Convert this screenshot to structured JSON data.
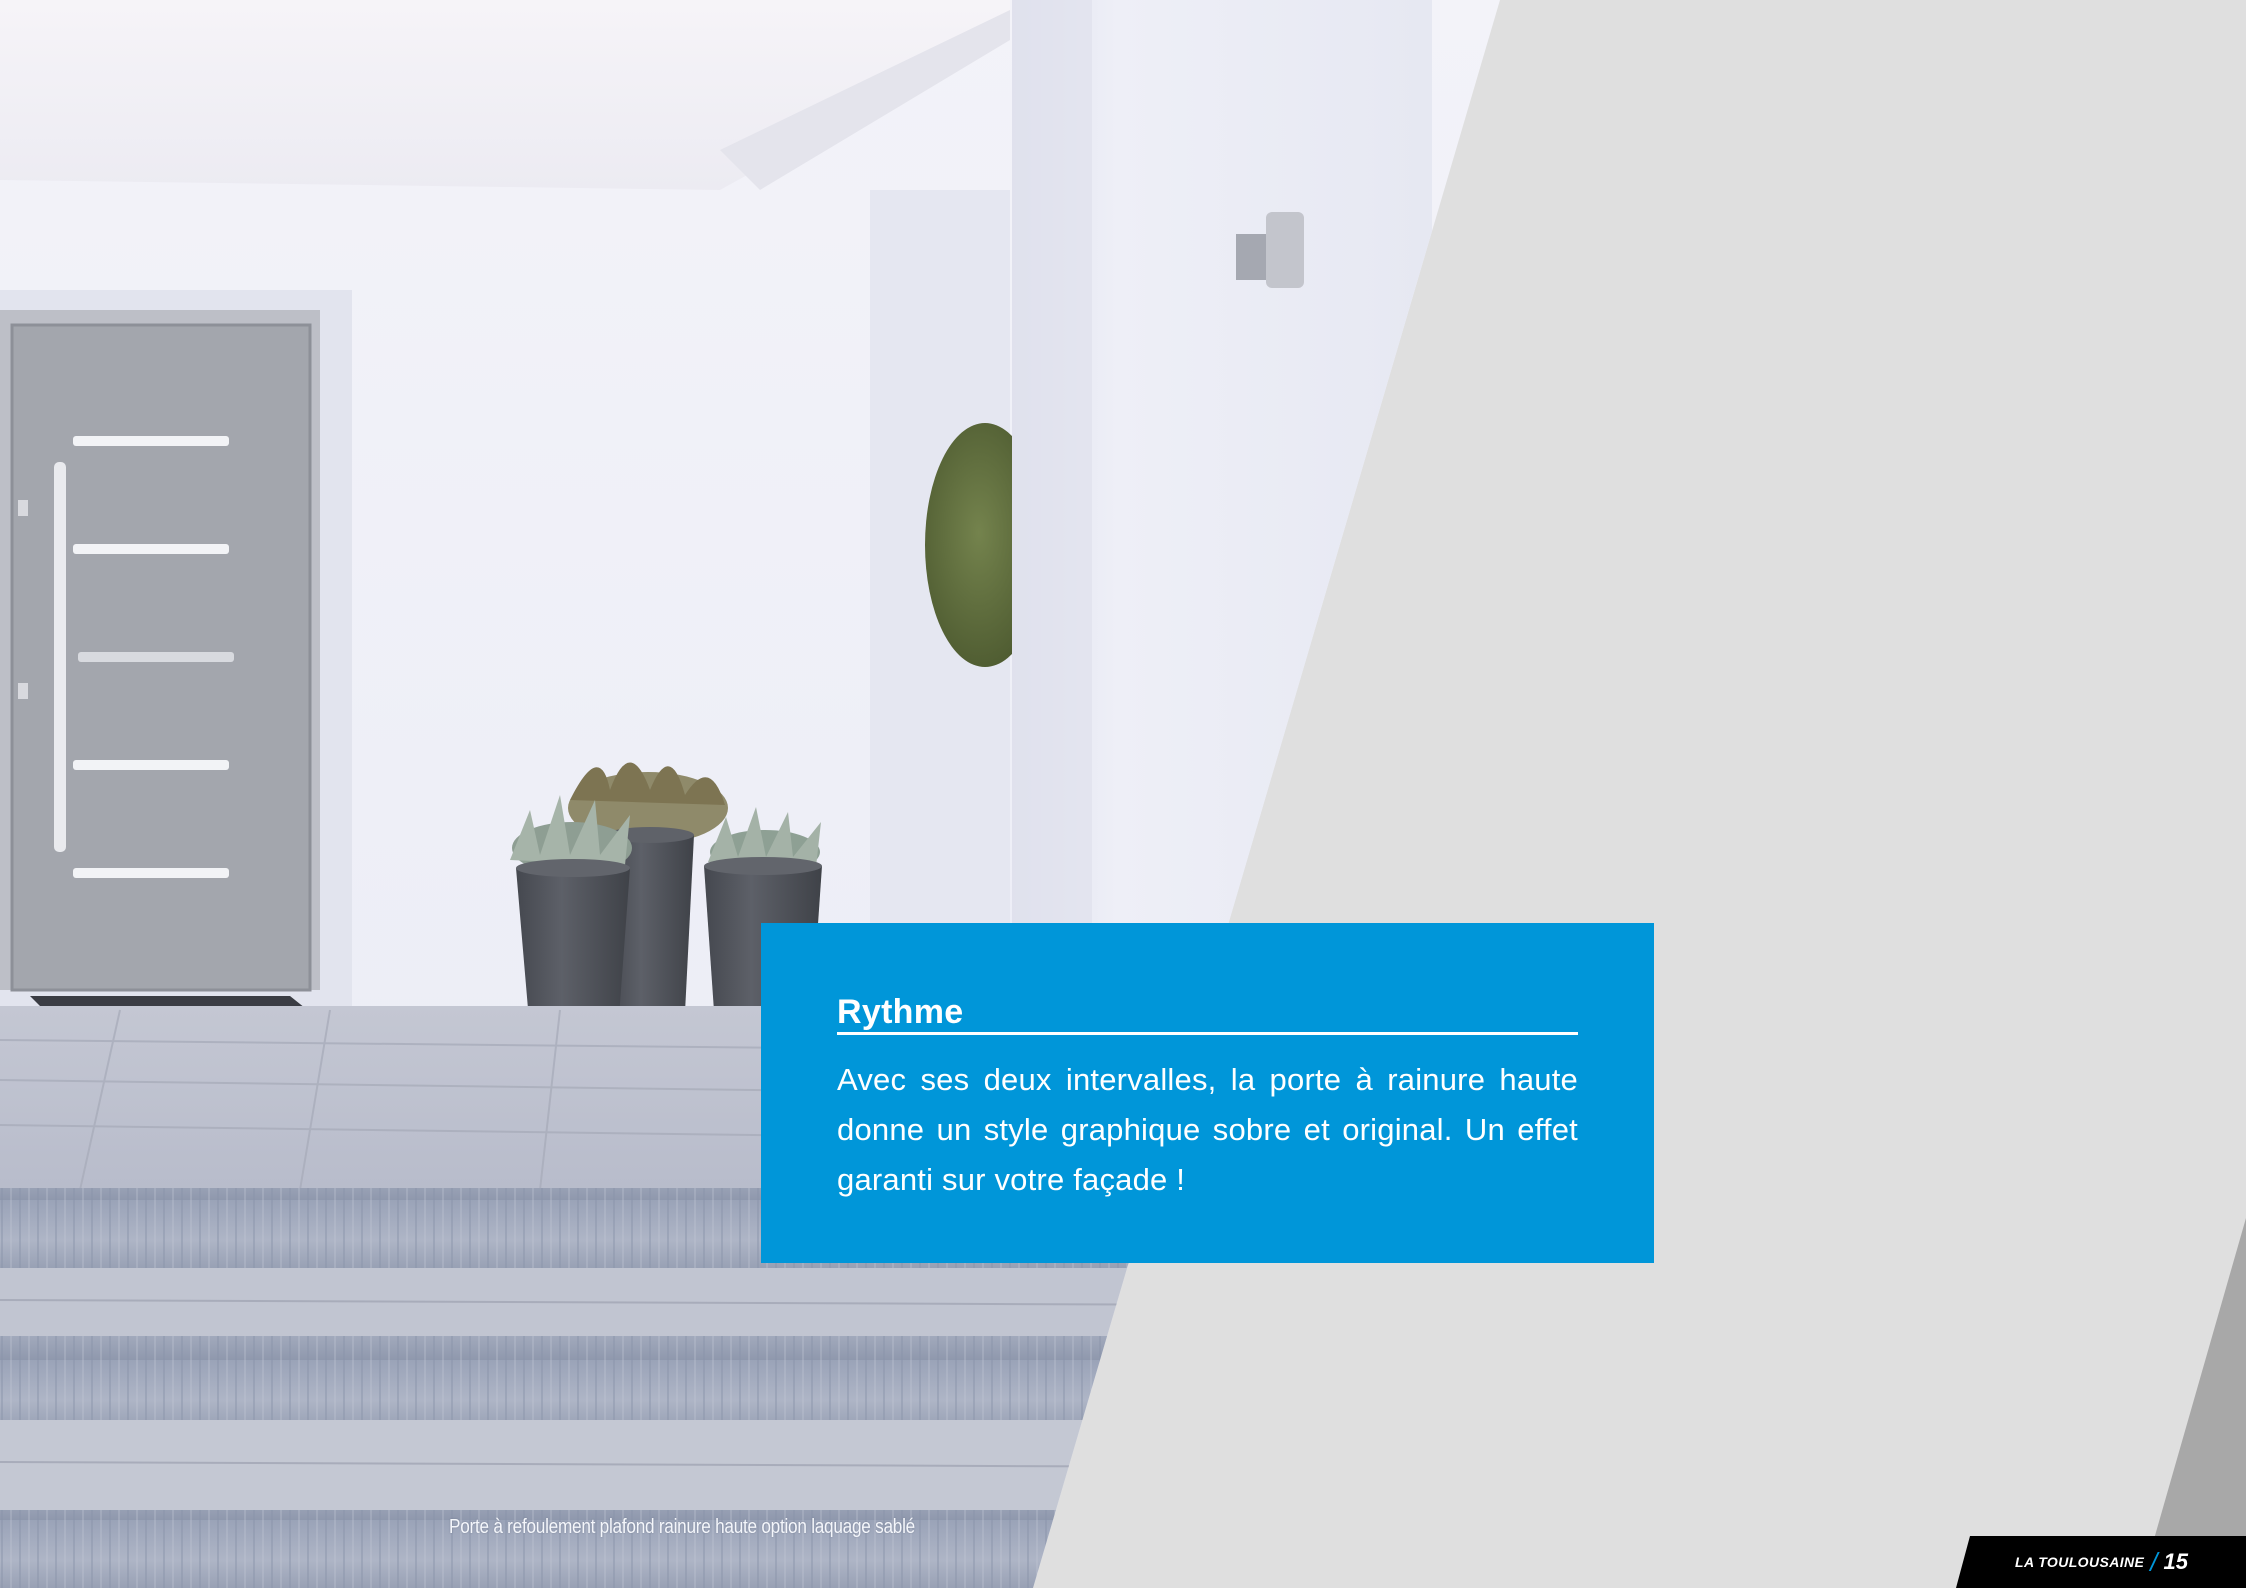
{
  "photo": {
    "description_icon": "house-entrance-photo",
    "colors": {
      "wall": "#eceef6",
      "door": "#a3a6ad",
      "stone": "#b2b8c6",
      "planter": "#4e5158",
      "hedge": "#5d6c3c",
      "background_panel": "#dfdfdf",
      "dark_wedge": "#a8a8a8"
    }
  },
  "caption": {
    "text": "Porte à refoulement plafond rainure haute option laquage sablé"
  },
  "callout": {
    "title": "Rythme",
    "body": "Avec ses deux intervalles, la porte à rainure haute donne un style graphique sobre et original. Un effet garanti sur votre façade !",
    "background": "#0096d9"
  },
  "footer": {
    "brand": "LA TOULOUSAINE",
    "separator": "/",
    "page_number": "15"
  }
}
